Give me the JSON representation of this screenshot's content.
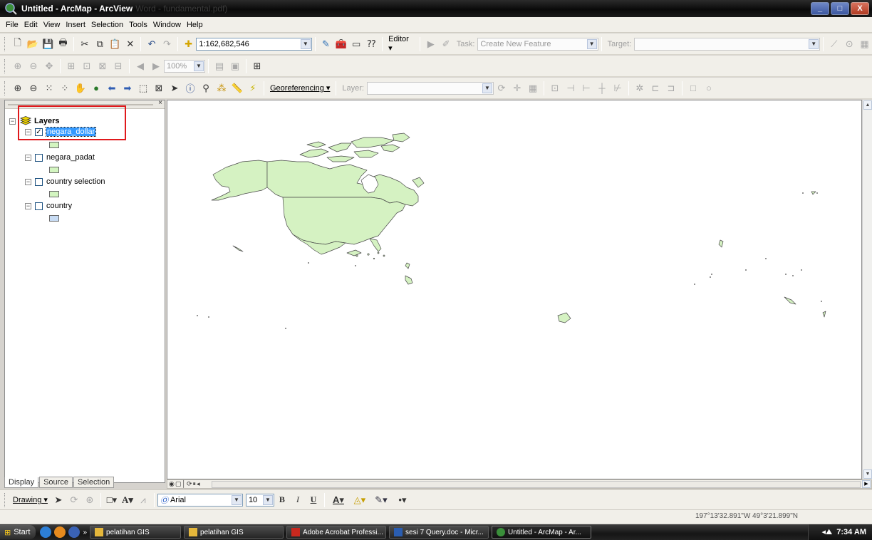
{
  "window": {
    "title": "Untitled - ArcMap - ArcView",
    "ghost_title": "Word - fundamental.pdf)",
    "controls": {
      "minimize": "_",
      "maximize": "□",
      "close": "X"
    }
  },
  "menu": [
    "File",
    "Edit",
    "View",
    "Insert",
    "Selection",
    "Tools",
    "Window",
    "Help"
  ],
  "standard_toolbar": {
    "scale_value": "1:162,682,546",
    "editor_label": "Editor ▾",
    "task_label": "Task:",
    "task_value": "Create New Feature",
    "target_label": "Target:"
  },
  "layout_toolbar": {
    "zoom_value": "100%"
  },
  "tools_toolbar": {
    "georeferencing_label": "Georeferencing ▾",
    "layer_label": "Layer:"
  },
  "toc": {
    "root_label": "Layers",
    "layers": [
      {
        "name": "negara_dollar",
        "checked": true,
        "selected": true,
        "swatch_color": "#d3f5c0"
      },
      {
        "name": "negara_padat",
        "checked": false,
        "selected": false,
        "swatch_color": "#d3f5c0"
      },
      {
        "name": "country selection",
        "checked": false,
        "selected": false,
        "swatch_color": "#d3f5c0"
      },
      {
        "name": "country",
        "checked": false,
        "selected": false,
        "swatch_color": "#c8dcf4"
      }
    ],
    "tabs": [
      "Display",
      "Source",
      "Selection"
    ]
  },
  "map": {
    "land_fill": "#d5f2c2",
    "outline": "#4a4a4a",
    "background": "#ffffff"
  },
  "drawing_toolbar": {
    "drawing_label": "Drawing ▾",
    "font_name": "Arial",
    "font_size": "10",
    "bold": "B",
    "italic": "I",
    "underline": "U"
  },
  "status": {
    "coordinates": "197°13'32.891\"W  49°3'21.899\"N"
  },
  "taskbar": {
    "start_label": "Start",
    "tasks": [
      "pelatihan GIS",
      "pelatihan GIS",
      "Adobe Acrobat Professi...",
      "sesi 7 Query.doc - Micr...",
      "Untitled - ArcMap - Ar..."
    ],
    "clock": "7:34 AM"
  }
}
